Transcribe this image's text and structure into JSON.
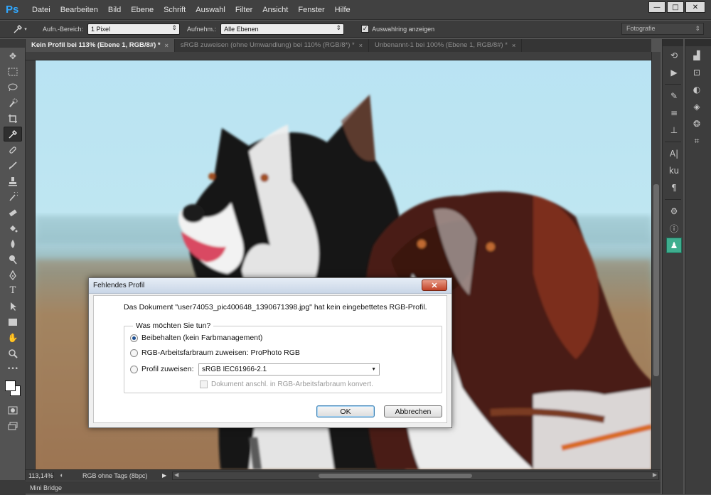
{
  "app": {
    "logo": "Ps",
    "menu": [
      "Datei",
      "Bearbeiten",
      "Bild",
      "Ebene",
      "Schrift",
      "Auswahl",
      "Filter",
      "Ansicht",
      "Fenster",
      "Hilfe"
    ],
    "window_controls": {
      "minimize": "—",
      "maximize": "□",
      "close": "✕"
    }
  },
  "options_bar": {
    "sample_size_label": "Aufn.-Bereich:",
    "sample_size_value": "1 Pixel",
    "sample_label": "Aufnehm.:",
    "sample_value": "Alle Ebenen",
    "show_ring_label": "Auswahlring anzeigen",
    "show_ring_checked": true,
    "workspace": "Fotografie"
  },
  "tabs": [
    {
      "label": "Kein Profil bei 113% (Ebene 1, RGB/8#) *",
      "active": true
    },
    {
      "label": "sRGB zuweisen (ohne Umwandlung) bei 110% (RGB/8*) *",
      "active": false
    },
    {
      "label": "Unbenannt-1 bei 100% (Ebene 1, RGB/8#) *",
      "active": false
    }
  ],
  "status": {
    "zoom": "113,14%",
    "doc_info": "RGB ohne Tags (8bpc)"
  },
  "mini_bridge": "Mini Bridge",
  "dialog": {
    "title": "Fehlendes Profil",
    "message": "Das Dokument \"user74053_pic400648_1390671398.jpg\" hat kein eingebettetes RGB-Profil.",
    "group_title": "Was möchten Sie tun?",
    "option_keep": "Beibehalten (kein Farbmanagement)",
    "option_assign_working": "RGB-Arbeitsfarbraum zuweisen: ProPhoto RGB",
    "option_assign_profile": "Profil zuweisen:",
    "profile_value": "sRGB IEC61966-2.1",
    "convert_checkbox": "Dokument anschl. in RGB-Arbeitsfarbraum konvert.",
    "ok": "OK",
    "cancel": "Abbrechen",
    "close": "✕"
  },
  "colors": {
    "accent": "#31a8ff",
    "panel_special": "#3fae8f",
    "dialog_close": "#c24328"
  }
}
